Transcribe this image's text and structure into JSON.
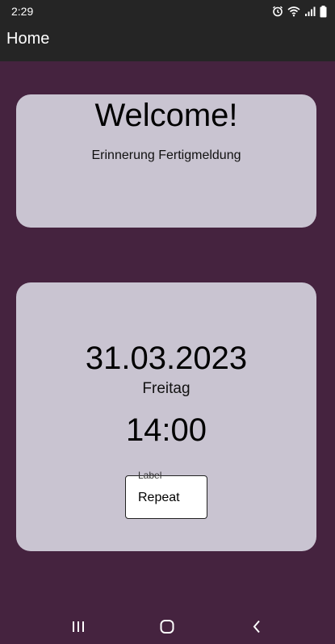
{
  "status_bar": {
    "time": "2:29"
  },
  "app_bar": {
    "title": "Home"
  },
  "welcome_card": {
    "title": "Welcome!",
    "subtitle": "Erinnerung Fertigmeldung"
  },
  "date_card": {
    "date": "31.03.2023",
    "weekday": "Freitag",
    "time": "14:00",
    "repeat_field": {
      "label": "Label",
      "value": "Repeat"
    }
  },
  "icons": {
    "status": [
      "alarm-icon",
      "wifi-icon",
      "signal-icon",
      "battery-icon"
    ],
    "nav": [
      "recents-icon",
      "home-icon",
      "back-icon"
    ]
  },
  "colors": {
    "background": "#45233f",
    "app_bar": "#252525",
    "card": "#c9c4d1",
    "text": "#000000"
  }
}
